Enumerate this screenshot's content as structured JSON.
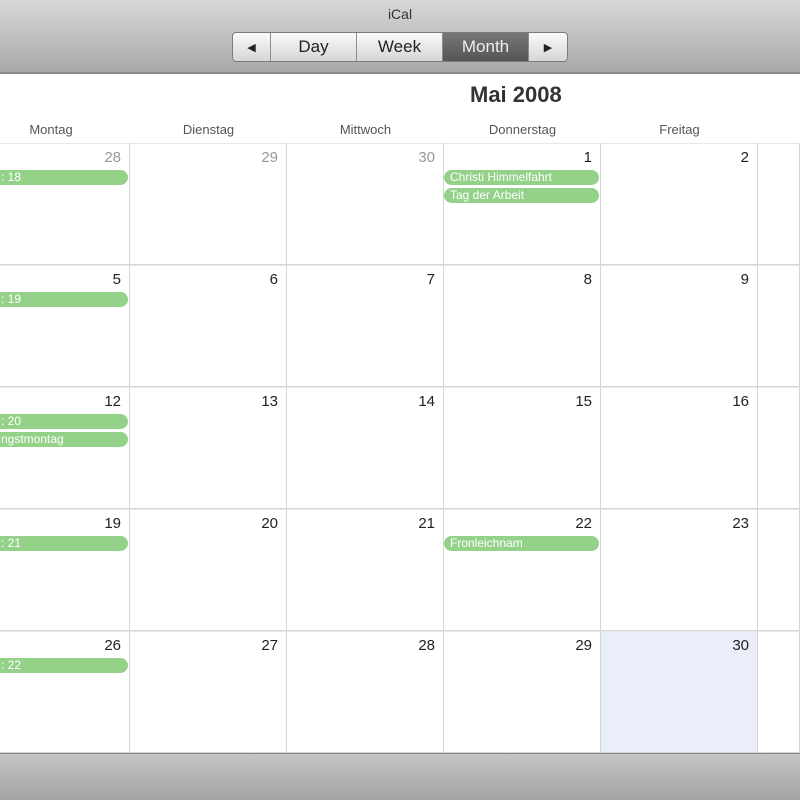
{
  "window": {
    "title": "iCal"
  },
  "nav": {
    "prev_icon": "triangle-left-icon",
    "prev": "◀",
    "day": "Day",
    "week": "Week",
    "month": "Month",
    "next": "▶",
    "next_icon": "triangle-right-icon",
    "selected": "Month"
  },
  "calendar": {
    "title": "Mai 2008",
    "weekdays": [
      "Montag",
      "Dienstag",
      "Mittwoch",
      "Donnerstag",
      "Freitag"
    ],
    "weeks": [
      [
        {
          "d": "28",
          "other": true,
          "events": [
            ": 18"
          ]
        },
        {
          "d": "29",
          "other": true,
          "events": []
        },
        {
          "d": "30",
          "other": true,
          "events": []
        },
        {
          "d": "1",
          "events": [
            "Christi Himmelfahrt",
            "Tag der Arbeit"
          ]
        },
        {
          "d": "2",
          "events": []
        }
      ],
      [
        {
          "d": "5",
          "events": [
            ": 19"
          ]
        },
        {
          "d": "6",
          "events": []
        },
        {
          "d": "7",
          "events": []
        },
        {
          "d": "8",
          "events": []
        },
        {
          "d": "9",
          "events": []
        }
      ],
      [
        {
          "d": "12",
          "events": [
            ": 20",
            "ngstmontag"
          ]
        },
        {
          "d": "13",
          "events": []
        },
        {
          "d": "14",
          "events": []
        },
        {
          "d": "15",
          "events": []
        },
        {
          "d": "16",
          "events": []
        }
      ],
      [
        {
          "d": "19",
          "events": [
            ": 21"
          ]
        },
        {
          "d": "20",
          "events": []
        },
        {
          "d": "21",
          "events": []
        },
        {
          "d": "22",
          "events": [
            "Fronleichnam"
          ]
        },
        {
          "d": "23",
          "events": []
        }
      ],
      [
        {
          "d": "26",
          "events": [
            ": 22"
          ]
        },
        {
          "d": "27",
          "events": []
        },
        {
          "d": "28",
          "events": []
        },
        {
          "d": "29",
          "events": []
        },
        {
          "d": "30",
          "today": true,
          "events": []
        }
      ]
    ],
    "event_color": "#94d28a",
    "today_color": "#e9eef8"
  }
}
